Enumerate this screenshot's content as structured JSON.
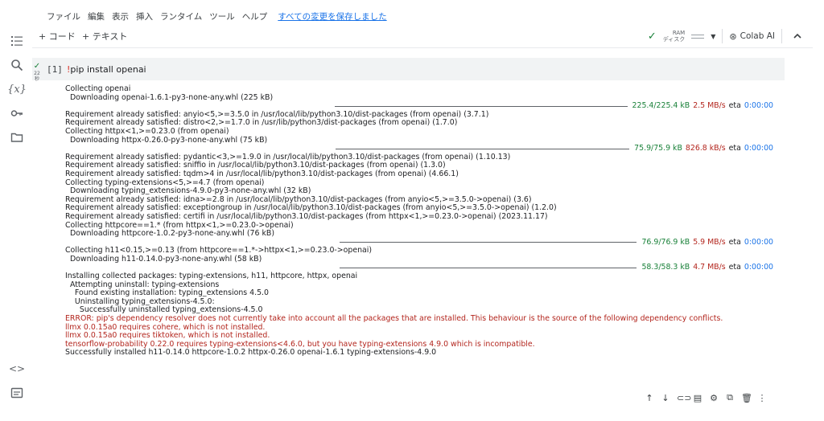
{
  "menu": {
    "items": [
      "ファイル",
      "編集",
      "表示",
      "挿入",
      "ランタイム",
      "ツール",
      "ヘルプ"
    ],
    "saved_status": "すべての変更を保存しました"
  },
  "toolbar": {
    "add_code": "+ コード",
    "add_text": "+ テキスト",
    "ram_label": "RAM",
    "disk_label": "ディスク",
    "colab_ai": "Colab AI"
  },
  "cell": {
    "status_time": "22",
    "status_unit": "秒",
    "exec_count": "[1]",
    "code_bang": "!",
    "code_rest": "pip install openai",
    "output": [
      {
        "t": "text",
        "v": "Collecting openai"
      },
      {
        "t": "text",
        "v": "  Downloading openai-1.6.1-py3-none-any.whl (225 kB)"
      },
      {
        "t": "progress",
        "done": "225.4/225.4 kB",
        "speed": "2.5 MB/s",
        "eta_label": "eta",
        "eta": "0:00:00"
      },
      {
        "t": "text",
        "v": "Requirement already satisfied: anyio<5,>=3.5.0 in /usr/local/lib/python3.10/dist-packages (from openai) (3.7.1)"
      },
      {
        "t": "text",
        "v": "Requirement already satisfied: distro<2,>=1.7.0 in /usr/lib/python3/dist-packages (from openai) (1.7.0)"
      },
      {
        "t": "text",
        "v": "Collecting httpx<1,>=0.23.0 (from openai)"
      },
      {
        "t": "text",
        "v": "  Downloading httpx-0.26.0-py3-none-any.whl (75 kB)"
      },
      {
        "t": "progress",
        "done": "75.9/75.9 kB",
        "speed": "826.8 kB/s",
        "eta_label": "eta",
        "eta": "0:00:00"
      },
      {
        "t": "text",
        "v": "Requirement already satisfied: pydantic<3,>=1.9.0 in /usr/local/lib/python3.10/dist-packages (from openai) (1.10.13)"
      },
      {
        "t": "text",
        "v": "Requirement already satisfied: sniffio in /usr/local/lib/python3.10/dist-packages (from openai) (1.3.0)"
      },
      {
        "t": "text",
        "v": "Requirement already satisfied: tqdm>4 in /usr/local/lib/python3.10/dist-packages (from openai) (4.66.1)"
      },
      {
        "t": "text",
        "v": "Collecting typing-extensions<5,>=4.7 (from openai)"
      },
      {
        "t": "text",
        "v": "  Downloading typing_extensions-4.9.0-py3-none-any.whl (32 kB)"
      },
      {
        "t": "text",
        "v": "Requirement already satisfied: idna>=2.8 in /usr/local/lib/python3.10/dist-packages (from anyio<5,>=3.5.0->openai) (3.6)"
      },
      {
        "t": "text",
        "v": "Requirement already satisfied: exceptiongroup in /usr/local/lib/python3.10/dist-packages (from anyio<5,>=3.5.0->openai) (1.2.0)"
      },
      {
        "t": "text",
        "v": "Requirement already satisfied: certifi in /usr/local/lib/python3.10/dist-packages (from httpx<1,>=0.23.0->openai) (2023.11.17)"
      },
      {
        "t": "text",
        "v": "Collecting httpcore==1.* (from httpx<1,>=0.23.0->openai)"
      },
      {
        "t": "text",
        "v": "  Downloading httpcore-1.0.2-py3-none-any.whl (76 kB)"
      },
      {
        "t": "progress",
        "done": "76.9/76.9 kB",
        "speed": "5.9 MB/s",
        "eta_label": "eta",
        "eta": "0:00:00"
      },
      {
        "t": "text",
        "v": "Collecting h11<0.15,>=0.13 (from httpcore==1.*->httpx<1,>=0.23.0->openai)"
      },
      {
        "t": "text",
        "v": "  Downloading h11-0.14.0-py3-none-any.whl (58 kB)"
      },
      {
        "t": "progress",
        "done": "58.3/58.3 kB",
        "speed": "4.7 MB/s",
        "eta_label": "eta",
        "eta": "0:00:00"
      },
      {
        "t": "text",
        "v": "Installing collected packages: typing-extensions, h11, httpcore, httpx, openai"
      },
      {
        "t": "text",
        "v": "  Attempting uninstall: typing-extensions"
      },
      {
        "t": "text",
        "v": "    Found existing installation: typing_extensions 4.5.0"
      },
      {
        "t": "text",
        "v": "    Uninstalling typing_extensions-4.5.0:"
      },
      {
        "t": "text",
        "v": "      Successfully uninstalled typing_extensions-4.5.0"
      },
      {
        "t": "err",
        "v": "ERROR: pip's dependency resolver does not currently take into account all the packages that are installed. This behaviour is the source of the following dependency conflicts."
      },
      {
        "t": "err",
        "v": "llmx 0.0.15a0 requires cohere, which is not installed."
      },
      {
        "t": "err",
        "v": "llmx 0.0.15a0 requires tiktoken, which is not installed."
      },
      {
        "t": "err",
        "v": "tensorflow-probability 0.22.0 requires typing-extensions<4.6.0, but you have typing-extensions 4.9.0 which is incompatible."
      },
      {
        "t": "text",
        "v": "Successfully installed h11-0.14.0 httpcore-1.0.2 httpx-0.26.0 openai-1.6.1 typing-extensions-4.9.0"
      }
    ]
  },
  "icons": {
    "rail": [
      "toc-icon",
      "search-icon",
      "variables-icon",
      "key-icon",
      "folder-icon",
      "code-snippets-icon",
      "terminal-icon"
    ],
    "cell_tools": [
      "arrow-up-icon",
      "arrow-down-icon",
      "link-icon",
      "comment-icon",
      "settings-icon",
      "mirror-icon",
      "delete-icon",
      "more-vert-icon"
    ]
  },
  "colors": {
    "progress_done": "#188038",
    "error_text": "#b3261e",
    "eta_value": "#1a73e8",
    "cell_header_bg": "#f1f3f4"
  }
}
